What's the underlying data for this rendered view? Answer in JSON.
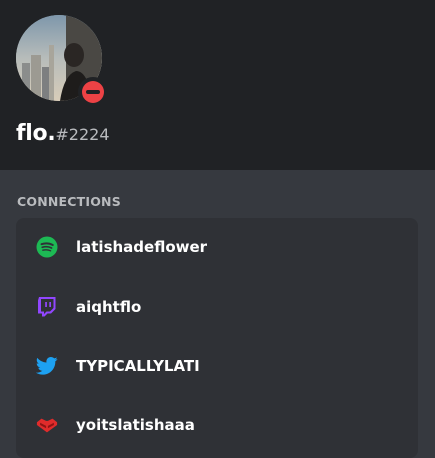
{
  "profile": {
    "username": "flo.",
    "discriminator": "#2224",
    "status": "do-not-disturb"
  },
  "connections": {
    "title": "CONNECTIONS",
    "items": [
      {
        "service": "spotify",
        "icon": "spotify-icon",
        "name": "latishadeflower"
      },
      {
        "service": "twitch",
        "icon": "twitch-icon",
        "name": "aiqhtflo"
      },
      {
        "service": "twitter",
        "icon": "twitter-icon",
        "name": "TYPICALLYLATI"
      },
      {
        "service": "youtube",
        "icon": "youtube-icon",
        "name": "yoitslatishaaa"
      }
    ]
  },
  "colors": {
    "spotify": "#1db954",
    "twitch": "#9146ff",
    "twitter": "#1da1f2",
    "youtube": "#e02b2b",
    "dnd": "#ed4245"
  }
}
